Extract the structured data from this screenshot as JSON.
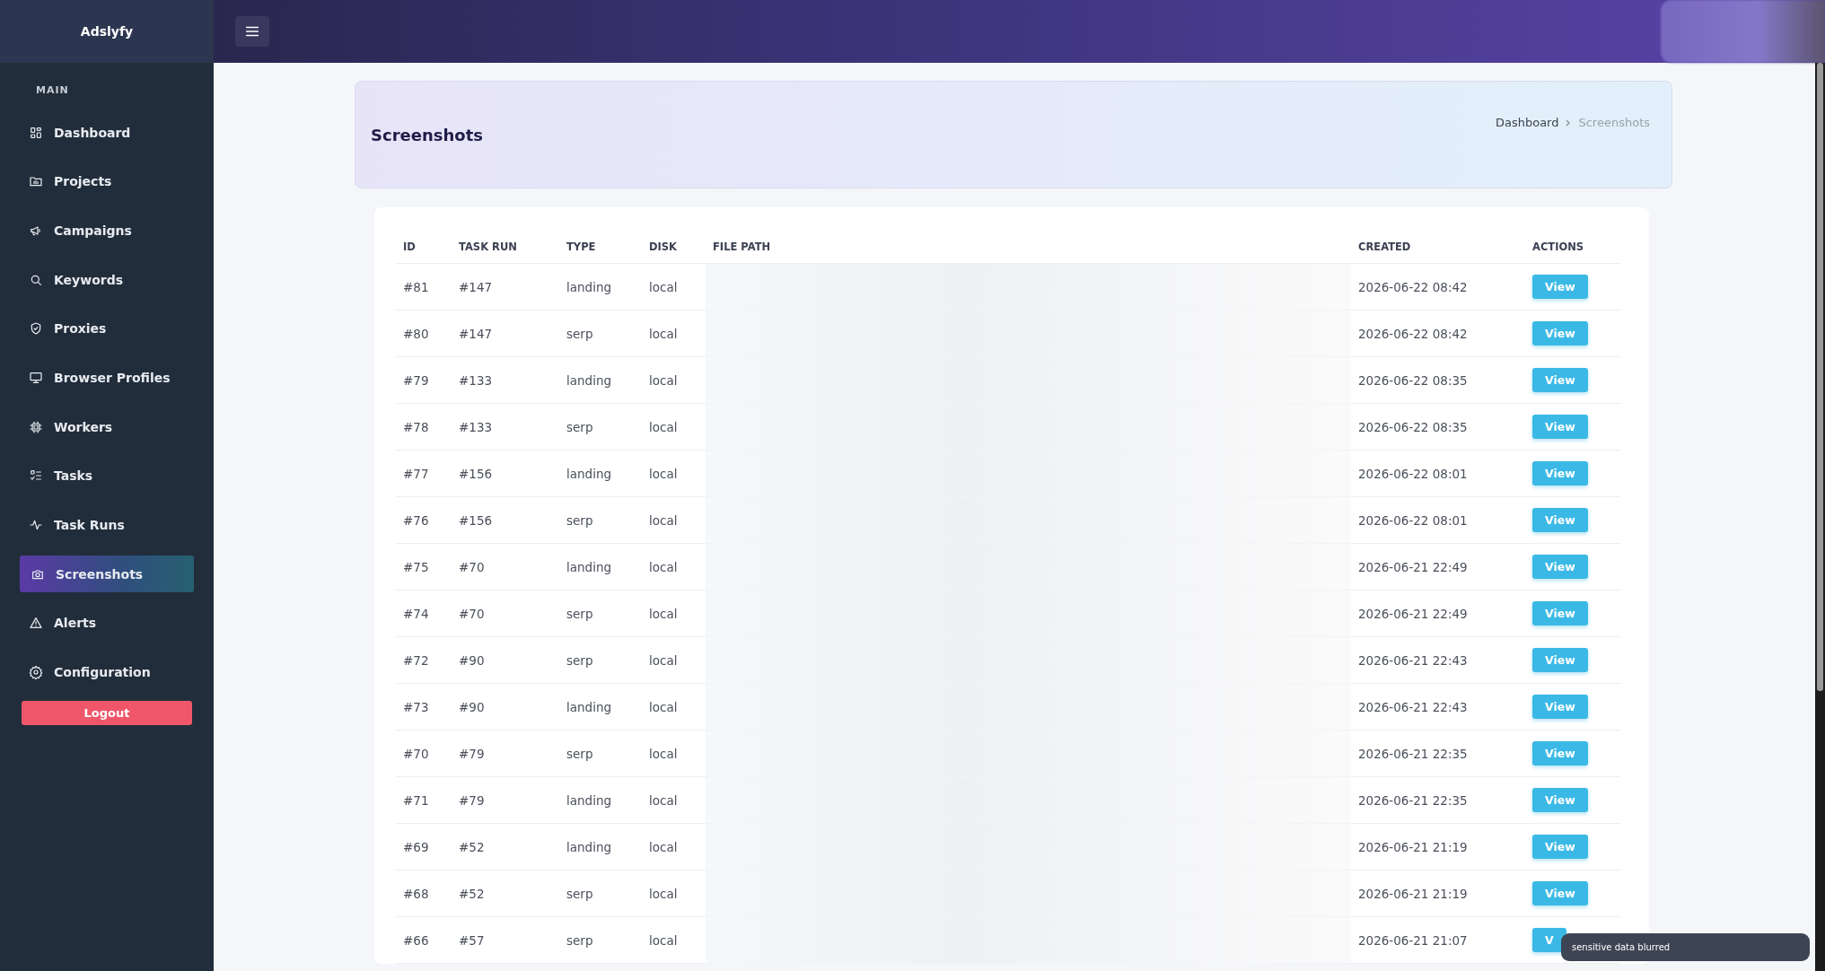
{
  "brand": "Adslyfy",
  "sidebar": {
    "section": "MAIN",
    "items": [
      {
        "label": "Dashboard",
        "selected": false
      },
      {
        "label": "Projects",
        "selected": false
      },
      {
        "label": "Campaigns",
        "selected": false
      },
      {
        "label": "Keywords",
        "selected": false
      },
      {
        "label": "Proxies",
        "selected": false
      },
      {
        "label": "Browser Profiles",
        "selected": false
      },
      {
        "label": "Workers",
        "selected": false
      },
      {
        "label": "Tasks",
        "selected": false
      },
      {
        "label": "Task Runs",
        "selected": false
      },
      {
        "label": "Screenshots",
        "selected": true
      },
      {
        "label": "Alerts",
        "selected": false
      },
      {
        "label": "Configuration",
        "selected": false
      }
    ],
    "logout": "Logout"
  },
  "page_title": "Screenshots",
  "breadcrumb": [
    "Dashboard",
    "Screenshots"
  ],
  "table": {
    "columns": [
      "ID",
      "TASK RUN",
      "TYPE",
      "DISK",
      "FILE PATH",
      "CREATED",
      "ACTIONS"
    ],
    "rows": [
      {
        "id": "#81",
        "task_run": "#147",
        "type": "landing",
        "disk": "local",
        "created": "2026-06-22 08:42",
        "action": "View"
      },
      {
        "id": "#80",
        "task_run": "#147",
        "type": "serp",
        "disk": "local",
        "created": "2026-06-22 08:42",
        "action": "View"
      },
      {
        "id": "#79",
        "task_run": "#133",
        "type": "landing",
        "disk": "local",
        "created": "2026-06-22 08:35",
        "action": "View"
      },
      {
        "id": "#78",
        "task_run": "#133",
        "type": "serp",
        "disk": "local",
        "created": "2026-06-22 08:35",
        "action": "View"
      },
      {
        "id": "#77",
        "task_run": "#156",
        "type": "landing",
        "disk": "local",
        "created": "2026-06-22 08:01",
        "action": "View"
      },
      {
        "id": "#76",
        "task_run": "#156",
        "type": "serp",
        "disk": "local",
        "created": "2026-06-22 08:01",
        "action": "View"
      },
      {
        "id": "#75",
        "task_run": "#70",
        "type": "landing",
        "disk": "local",
        "created": "2026-06-21 22:49",
        "action": "View"
      },
      {
        "id": "#74",
        "task_run": "#70",
        "type": "serp",
        "disk": "local",
        "created": "2026-06-21 22:49",
        "action": "View"
      },
      {
        "id": "#72",
        "task_run": "#90",
        "type": "serp",
        "disk": "local",
        "created": "2026-06-21 22:43",
        "action": "View"
      },
      {
        "id": "#73",
        "task_run": "#90",
        "type": "landing",
        "disk": "local",
        "created": "2026-06-21 22:43",
        "action": "View"
      },
      {
        "id": "#70",
        "task_run": "#79",
        "type": "serp",
        "disk": "local",
        "created": "2026-06-21 22:35",
        "action": "View"
      },
      {
        "id": "#71",
        "task_run": "#79",
        "type": "landing",
        "disk": "local",
        "created": "2026-06-21 22:35",
        "action": "View"
      },
      {
        "id": "#69",
        "task_run": "#52",
        "type": "landing",
        "disk": "local",
        "created": "2026-06-21 21:19",
        "action": "View"
      },
      {
        "id": "#68",
        "task_run": "#52",
        "type": "serp",
        "disk": "local",
        "created": "2026-06-21 21:19",
        "action": "View"
      },
      {
        "id": "#66",
        "task_run": "#57",
        "type": "serp",
        "disk": "local",
        "created": "2026-06-21 21:07",
        "action": "V"
      }
    ]
  },
  "toast": "sensitive data blurred"
}
